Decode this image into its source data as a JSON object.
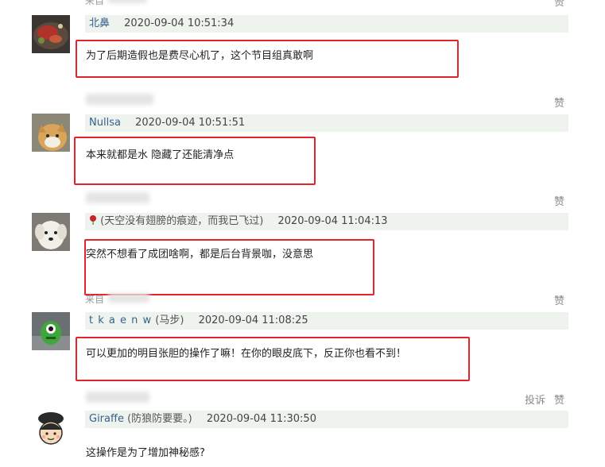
{
  "like_label": "赞",
  "report_label": "投诉",
  "source_label": "来自",
  "comments": [
    {
      "name": "北鼻",
      "note": "",
      "time": "2020-09-04 10:51:34",
      "text": "为了后期造假也是费尽心机了，这个节目组真敢啊",
      "avatar": "food-photo-avatar"
    },
    {
      "name": "Nullsa",
      "note": "",
      "time": "2020-09-04 10:51:51",
      "text": "本来就都是水 隐藏了还能清净点",
      "avatar": "cat-photo-avatar"
    },
    {
      "name": "",
      "note": "(天空没有翅膀的痕迹，而我已飞过)",
      "time": "2020-09-04 11:04:13",
      "text": "突然不想看了成团啥啊，都是后台背景咖，没意思",
      "avatar": "white-dog-avatar"
    },
    {
      "name": "t k a e n w",
      "note": "(马步)",
      "time": "2020-09-04 11:08:25",
      "text": "可以更加的明目张胆的操作了嘛！在你的眼皮底下，反正你也看不到！",
      "avatar": "green-monster-avatar"
    },
    {
      "name": "Giraffe",
      "note": "(防狼防要要。)",
      "time": "2020-09-04 11:30:50",
      "text": "这操作是为了增加神秘感?",
      "avatar": "cartoon-chef-avatar"
    }
  ]
}
